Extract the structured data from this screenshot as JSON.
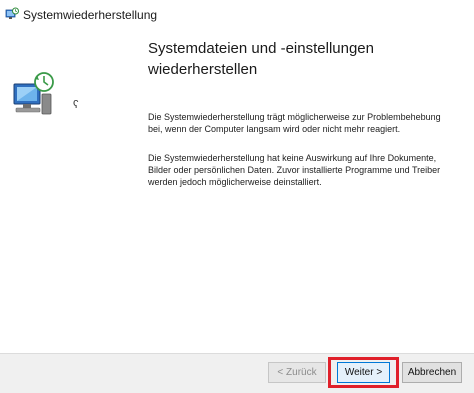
{
  "window": {
    "title": "Systemwiederherstellung"
  },
  "content": {
    "heading": "Systemdateien und -einstellungen wiederherstellen",
    "paragraph_1": "Die Systemwiederherstellung trägt möglicherweise zur Problembehebung bei, wenn der Computer langsam wird oder nicht mehr reagiert.",
    "paragraph_2": "Die Systemwiederherstellung hat keine Auswirkung auf Ihre Dokumente, Bilder oder persönlichen Daten. Zuvor installierte Programme und Treiber werden jedoch möglicherweise deinstalliert."
  },
  "buttons": {
    "back_label": "< Zurück",
    "next_label": "Weiter >",
    "cancel_label": "Abbrechen"
  },
  "icons": {
    "title_icon": "system-restore-icon",
    "wizard_icon": "system-restore-computer-icon"
  },
  "colors": {
    "highlight": "#e0202a",
    "focus_border": "#0078d7"
  }
}
